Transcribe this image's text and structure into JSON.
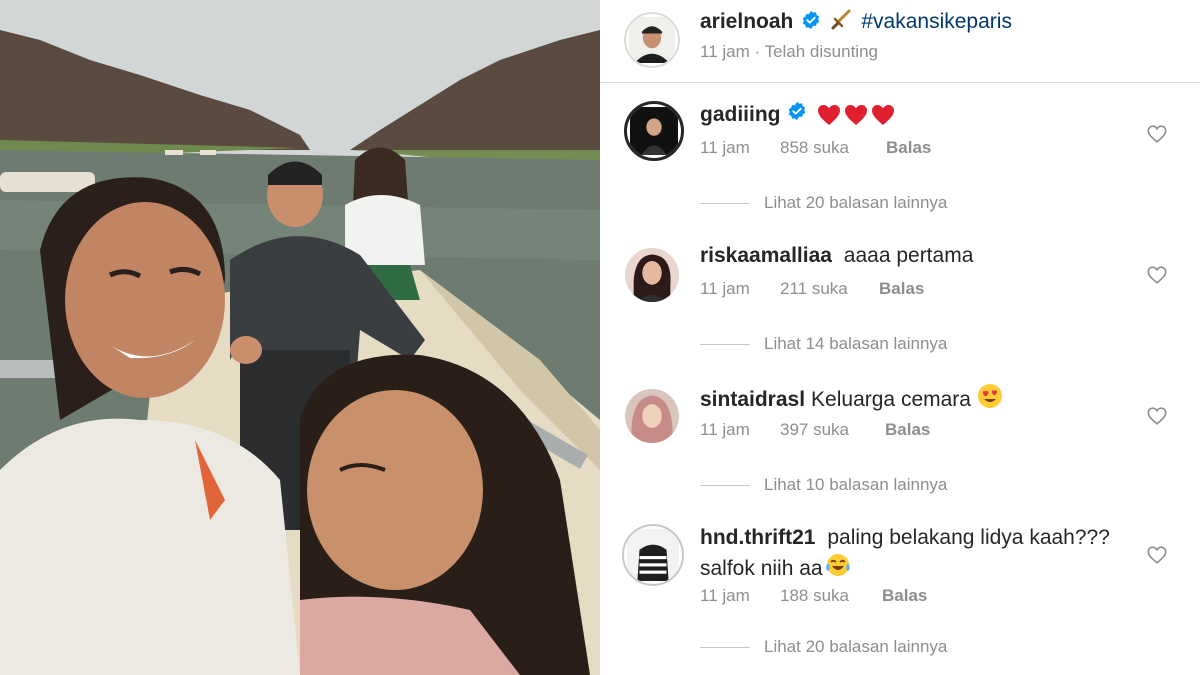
{
  "post": {
    "author": "arielnoah",
    "caption": "#vakansikeparis",
    "time_text": "11 jam · Telah disunting",
    "icons": [
      "verified-badge-icon",
      "sword-emoji"
    ]
  },
  "comments": [
    {
      "username": "gadiiing",
      "text": "",
      "emoji": "three-red-hearts",
      "time": "11 jam",
      "likes": "858 suka",
      "reply_label": "Balas",
      "view_replies": "Lihat 20 balasan lainnya",
      "verified": true
    },
    {
      "username": "riskaamalliaa",
      "text": "aaaa pertama",
      "time": "11 jam",
      "likes": "211 suka",
      "reply_label": "Balas",
      "view_replies": "Lihat 14 balasan lainnya"
    },
    {
      "username": "sintaidrasl",
      "text": "Keluarga cemara",
      "emoji": "heart-eyes-emoji",
      "time": "11 jam",
      "likes": "397 suka",
      "reply_label": "Balas",
      "view_replies": "Lihat 10 balasan lainnya"
    },
    {
      "username": "hnd.thrift21",
      "text": "paling belakang lidya kaah???",
      "text_line2": "salfok niih aa",
      "emoji": "tears-of-joy-emoji",
      "time": "11 jam",
      "likes": "188 suka",
      "reply_label": "Balas",
      "view_replies": "Lihat 20 balasan lainnya"
    }
  ],
  "colors": {
    "verified_blue": "#0095f6",
    "heart_red": "#ed4956",
    "meta_gray": "#8e8e8e",
    "text_dark": "#262626"
  }
}
